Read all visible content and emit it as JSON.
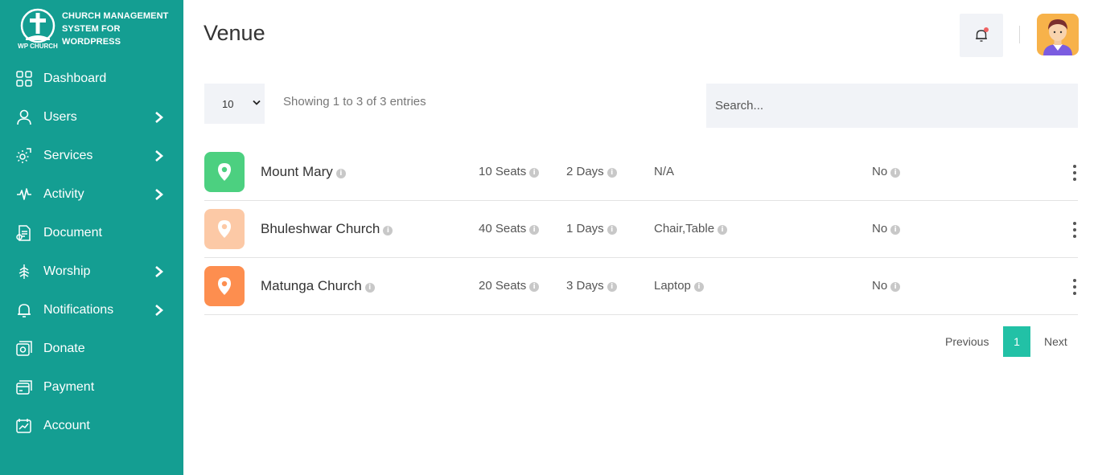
{
  "brand": {
    "logo_caption": "WP CHURCH",
    "line1": "CHURCH MANAGEMENT",
    "line2": "SYSTEM FOR",
    "line3": "WORDPRESS"
  },
  "sidebar": {
    "items": [
      {
        "label": "Dashboard",
        "icon": "dashboard-icon",
        "has_submenu": false
      },
      {
        "label": "Users",
        "icon": "user-icon",
        "has_submenu": true
      },
      {
        "label": "Services",
        "icon": "gear-icon",
        "has_submenu": true
      },
      {
        "label": "Activity",
        "icon": "activity-icon",
        "has_submenu": true
      },
      {
        "label": "Document",
        "icon": "document-icon",
        "has_submenu": false
      },
      {
        "label": "Worship",
        "icon": "worship-icon",
        "has_submenu": true
      },
      {
        "label": "Notifications",
        "icon": "bell-icon",
        "has_submenu": true
      },
      {
        "label": "Donate",
        "icon": "donate-icon",
        "has_submenu": false
      },
      {
        "label": "Payment",
        "icon": "payment-icon",
        "has_submenu": false
      },
      {
        "label": "Account",
        "icon": "account-icon",
        "has_submenu": false
      }
    ]
  },
  "header": {
    "title": "Venue"
  },
  "controls": {
    "page_length": "10",
    "page_length_options": [
      "10"
    ],
    "info": "Showing 1 to 3 of 3 entries",
    "search_placeholder": "Search..."
  },
  "rows": [
    {
      "name": "Mount Mary",
      "seats": "10 Seats",
      "days": "2 Days",
      "items": "N/A",
      "flag": "No",
      "color": "#4cd080"
    },
    {
      "name": "Bhuleshwar Church",
      "seats": "40 Seats",
      "days": "1 Days",
      "items": "Chair,Table",
      "flag": "No",
      "color": "#fcc9a6"
    },
    {
      "name": "Matunga Church",
      "seats": "20 Seats",
      "days": "3 Days",
      "items": "Laptop",
      "flag": "No",
      "color": "#fd8e4f"
    }
  ],
  "pagination": {
    "previous": "Previous",
    "current": "1",
    "next": "Next"
  },
  "colors": {
    "sidebar": "#149e92",
    "accent": "#22c1a6",
    "notification_dot": "#f06262"
  }
}
